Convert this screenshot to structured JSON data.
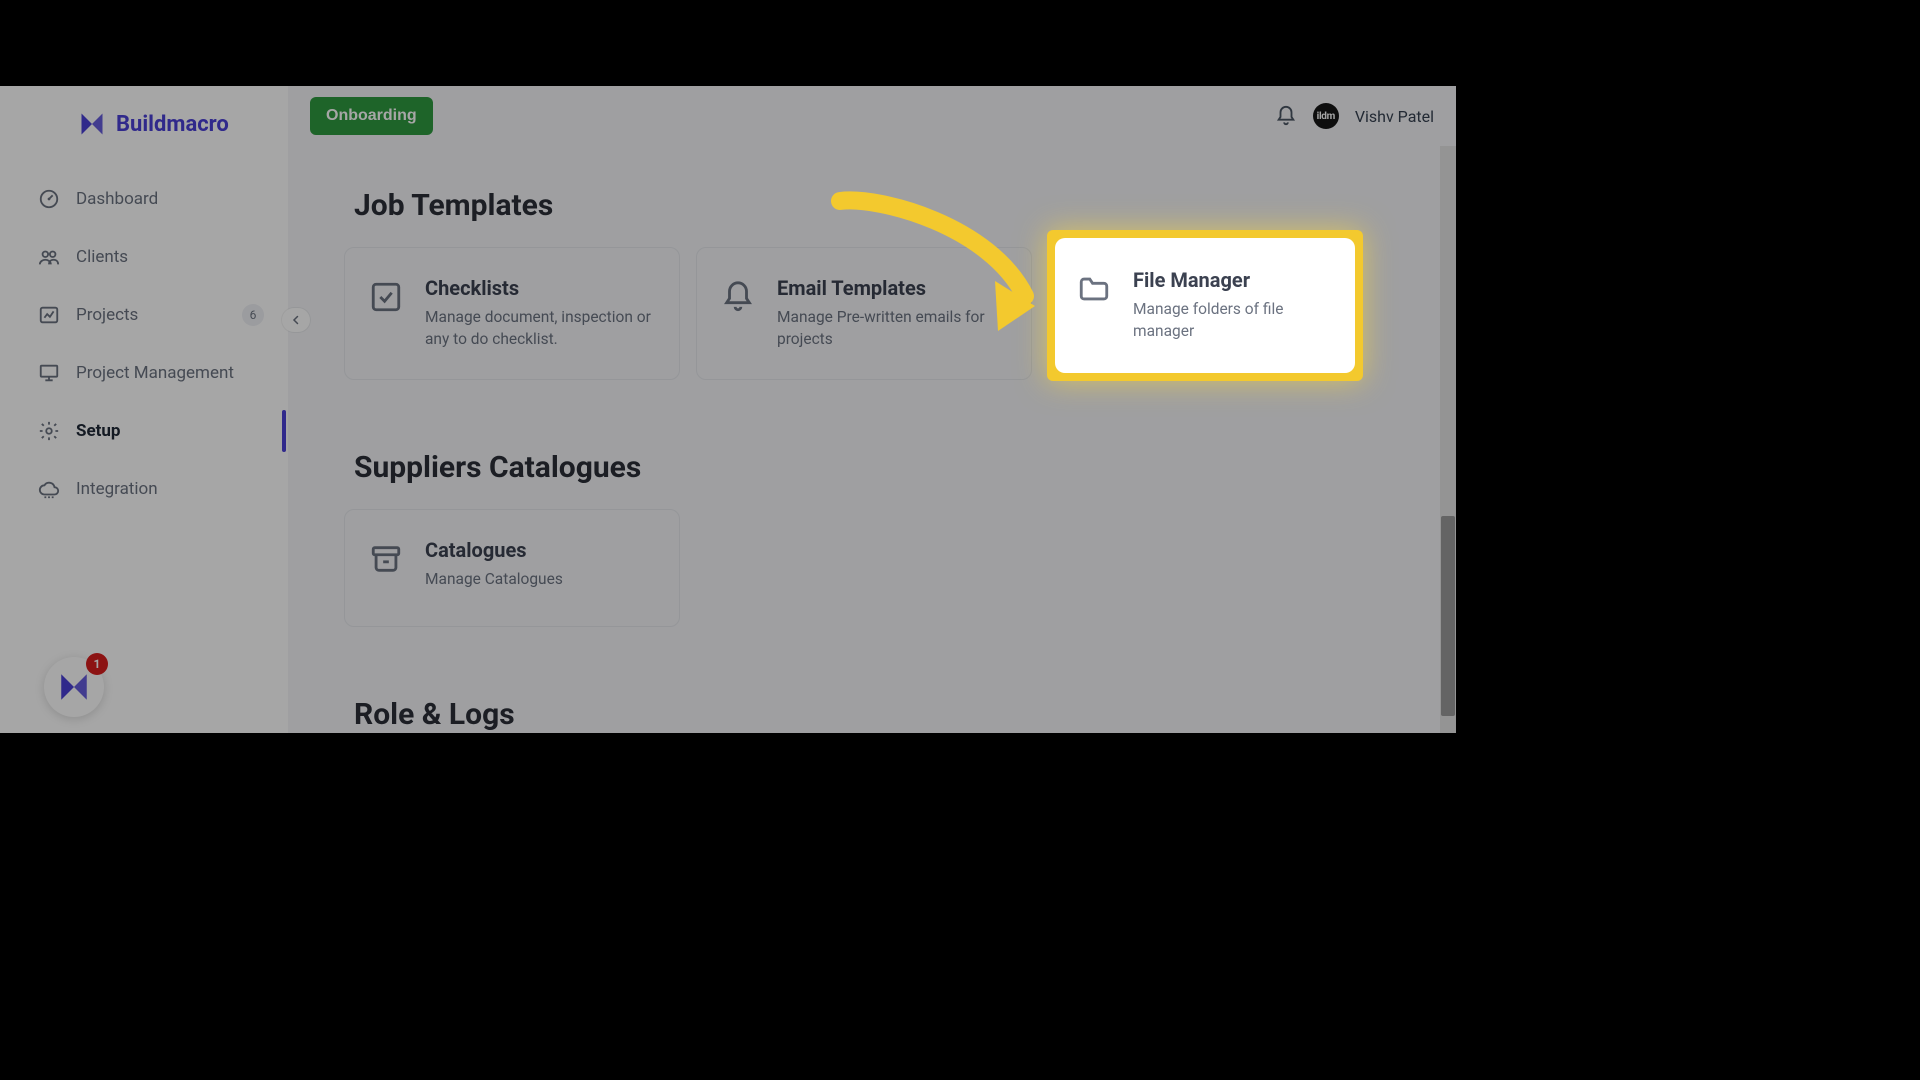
{
  "brand": {
    "name": "Buildmacro"
  },
  "topbar": {
    "onboarding_label": "Onboarding",
    "user_name": "Vishv Patel",
    "avatar_text": "ildm"
  },
  "sidebar": {
    "items": [
      {
        "label": "Dashboard"
      },
      {
        "label": "Clients"
      },
      {
        "label": "Projects",
        "badge": "6"
      },
      {
        "label": "Project Management"
      },
      {
        "label": "Setup"
      },
      {
        "label": "Integration"
      }
    ],
    "help_badge": "1"
  },
  "sections": {
    "job_templates": {
      "title": "Job Templates",
      "cards": [
        {
          "title": "Checklists",
          "desc": "Manage document, inspection or any to do checklist."
        },
        {
          "title": "Email Templates",
          "desc": "Manage Pre-written emails for projects"
        },
        {
          "title": "File Manager",
          "desc": "Manage folders of file manager"
        }
      ]
    },
    "suppliers": {
      "title": "Suppliers Catalogues",
      "cards": [
        {
          "title": "Catalogues",
          "desc": "Manage Catalogues"
        }
      ]
    },
    "roles": {
      "title": "Role & Logs"
    }
  },
  "annotation": {
    "highlight_card_index": 2
  }
}
